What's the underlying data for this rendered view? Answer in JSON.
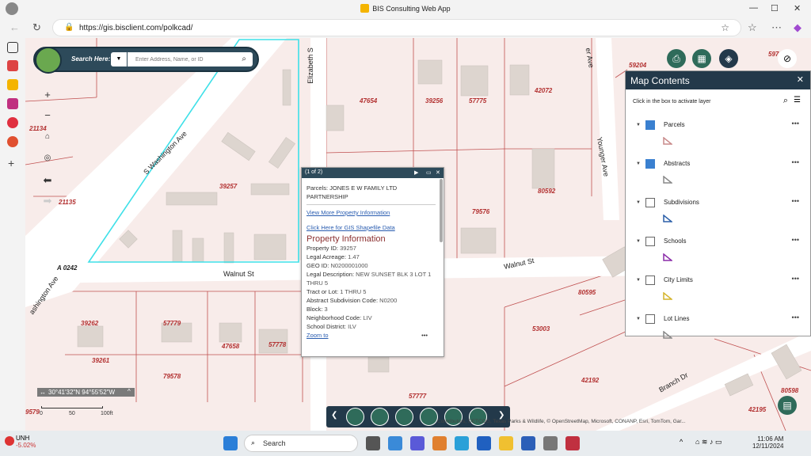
{
  "window": {
    "title": "BIS Consulting Web App"
  },
  "browser": {
    "url": "https://gis.bisclient.com/polkcad/"
  },
  "search": {
    "label": "Search Here:",
    "placeholder": "Enter Address, Name, or ID"
  },
  "map": {
    "parcel_ids": [
      {
        "id": "59204"
      },
      {
        "id": "47654"
      },
      {
        "id": "39256"
      },
      {
        "id": "57775"
      },
      {
        "id": "42072"
      },
      {
        "id": "21134"
      },
      {
        "id": "39257"
      },
      {
        "id": "80592"
      },
      {
        "id": "21135"
      },
      {
        "id": "79576"
      },
      {
        "id": "80595"
      },
      {
        "id": "39262"
      },
      {
        "id": "57779"
      },
      {
        "id": "47658"
      },
      {
        "id": "57778"
      },
      {
        "id": "53003"
      },
      {
        "id": "39261"
      },
      {
        "id": "79578"
      },
      {
        "id": "42192"
      },
      {
        "id": "80598"
      },
      {
        "id": "42195"
      },
      {
        "id": "57777"
      },
      {
        "id": "9579"
      },
      {
        "id": "597"
      },
      {
        "id": "A 0242"
      }
    ],
    "streets": {
      "washington": "S Washington Ave",
      "elizabeth": "Elizabeth S",
      "younger": "Younger Ave",
      "walnut_left": "Walnut St",
      "walnut_right": "Walnut St",
      "branch": "Branch Dr",
      "washington_lower": "ashington Ave",
      "ave_top": "er Ave"
    }
  },
  "popup": {
    "counter": "(1 of 2)",
    "parcel": "Parcels: JONES E W FAMILY LTD PARTNERSHIP",
    "link1": "View More Property Information",
    "link2": "Click Here for GIS Shapefile Data",
    "heading": "Property Information",
    "rows": [
      {
        "k": "Property ID:",
        "v": "39257"
      },
      {
        "k": "Legal Acreage:",
        "v": "1.47"
      },
      {
        "k": "GEO ID:",
        "v": "N0200001000"
      },
      {
        "k": "Legal Description:",
        "v": "NEW SUNSET BLK 3 LOT 1 THRU 5"
      },
      {
        "k": "Tract or Lot:",
        "v": "1 THRU 5"
      },
      {
        "k": "Abstract Subdivision Code:",
        "v": "N0200"
      },
      {
        "k": "Block:",
        "v": "3"
      },
      {
        "k": "Neighborhood Code:",
        "v": "LIV"
      },
      {
        "k": "School District:",
        "v": "ILV"
      }
    ],
    "zoom": "Zoom to"
  },
  "panel": {
    "title": "Map Contents",
    "subtitle": "Click in the box to activate layer",
    "layers": [
      {
        "name": "Parcels",
        "checked": true,
        "color": "#c98a8a"
      },
      {
        "name": "Abstracts",
        "checked": true,
        "color": "#888"
      },
      {
        "name": "Subdivisions",
        "checked": false,
        "color": "#2b5fa8"
      },
      {
        "name": "Schools",
        "checked": false,
        "color": "#8a2ba8"
      },
      {
        "name": "City Limits",
        "checked": false,
        "color": "#d4b42a"
      },
      {
        "name": "Lot Lines",
        "checked": false,
        "color": "#888"
      }
    ]
  },
  "coords": "30°41'32\"N 94°55'52\"W",
  "scale": {
    "a": "0",
    "b": "50",
    "c": "100ft"
  },
  "attribution": "Contributors, DETCOG, Texas Parks & Wildlife, © OpenStreetMap, Microsoft, CONANP, Esri, TomTom, Gar...",
  "taskbar": {
    "ticker": "UNH",
    "change": "-5.02%",
    "search": "Search",
    "time": "11:06 AM",
    "date": "12/11/2024"
  }
}
